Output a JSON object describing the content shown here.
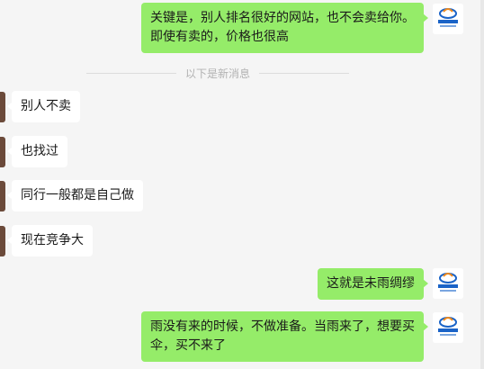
{
  "divider": {
    "text": "以下是新消息"
  },
  "messages": [
    {
      "side": "right",
      "text": "关键是，别人排名很好的网站，也不会卖给你。即使有卖的，价格也很高"
    },
    {
      "side": "left",
      "text": "别人不卖"
    },
    {
      "side": "left",
      "text": "也找过"
    },
    {
      "side": "left",
      "text": "同行一般都是自己做"
    },
    {
      "side": "left",
      "text": "现在竞争大"
    },
    {
      "side": "right",
      "text": "这就是未雨绸缪"
    },
    {
      "side": "right",
      "text": "雨没有来的时候，不做准备。当雨来了，想要买伞，买不来了"
    }
  ],
  "avatar": {
    "icon": "brand-logo-avatar",
    "accent": "#1a63c7",
    "accent2": "#f08a1c"
  }
}
